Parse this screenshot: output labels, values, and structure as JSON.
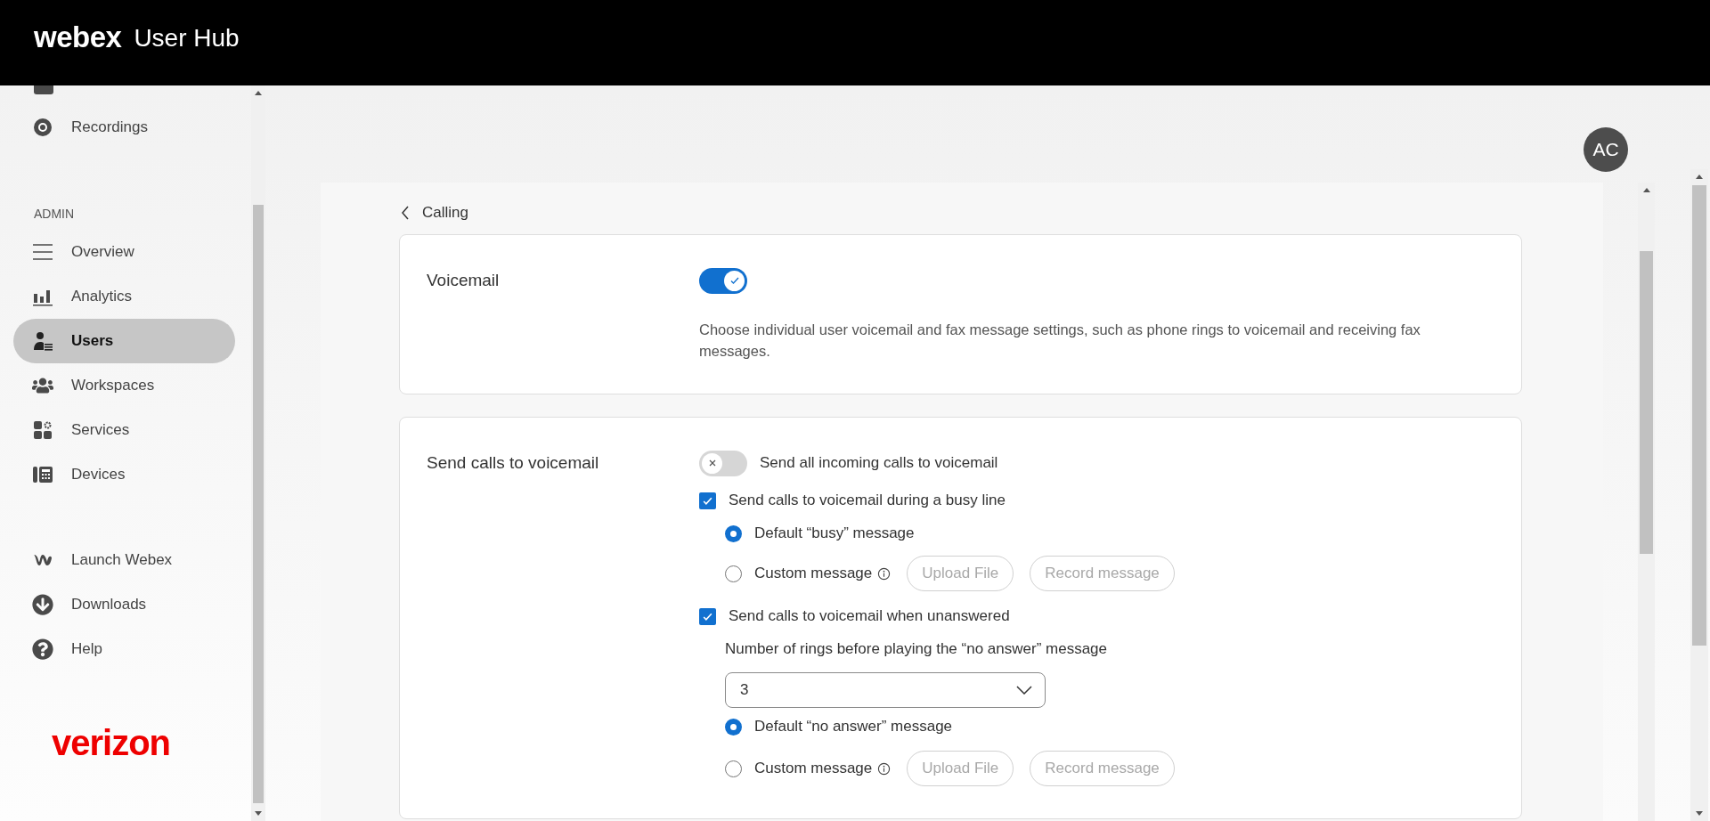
{
  "header": {
    "logo": "webex",
    "title": "User Hub"
  },
  "sidebar": {
    "top_items": [
      {
        "label": "Recordings",
        "selected": false
      }
    ],
    "section_label": "ADMIN",
    "admin_items": [
      {
        "label": "Overview",
        "selected": false
      },
      {
        "label": "Analytics",
        "selected": false
      },
      {
        "label": "Users",
        "selected": true
      },
      {
        "label": "Workspaces",
        "selected": false
      },
      {
        "label": "Services",
        "selected": false
      },
      {
        "label": "Devices",
        "selected": false
      }
    ],
    "bottom_items": [
      {
        "label": "Launch Webex"
      },
      {
        "label": "Downloads"
      },
      {
        "label": "Help"
      }
    ],
    "brand": "verizon"
  },
  "avatar": {
    "initials": "AC"
  },
  "back_link": "Calling",
  "voicemail": {
    "label": "Voicemail",
    "on": true,
    "description": "Choose individual user voicemail and fax message settings, such as phone rings to voicemail and receiving fax messages."
  },
  "send_calls": {
    "label": "Send calls to voicemail",
    "all_calls": {
      "label": "Send all incoming calls to voicemail",
      "on": false
    },
    "busy": {
      "label": "Send calls to voicemail during a busy line",
      "checked": true,
      "options": [
        {
          "label": "Default “busy” message",
          "selected": true,
          "kind": "default"
        },
        {
          "label": "Custom message",
          "selected": false,
          "kind": "custom",
          "buttons": [
            {
              "label": "Upload File",
              "disabled": true
            },
            {
              "label": "Record message",
              "disabled": true
            }
          ]
        }
      ]
    },
    "unanswered": {
      "label": "Send calls to voicemail when unanswered",
      "checked": true,
      "rings_label": "Number of rings before playing the “no answer” message",
      "rings_value": "3",
      "options": [
        {
          "label": "Default “no answer” message",
          "selected": true,
          "kind": "default"
        },
        {
          "label": "Custom message",
          "selected": false,
          "kind": "custom",
          "buttons": [
            {
              "label": "Upload File",
              "disabled": true
            },
            {
              "label": "Record message",
              "disabled": true
            }
          ]
        }
      ]
    }
  }
}
